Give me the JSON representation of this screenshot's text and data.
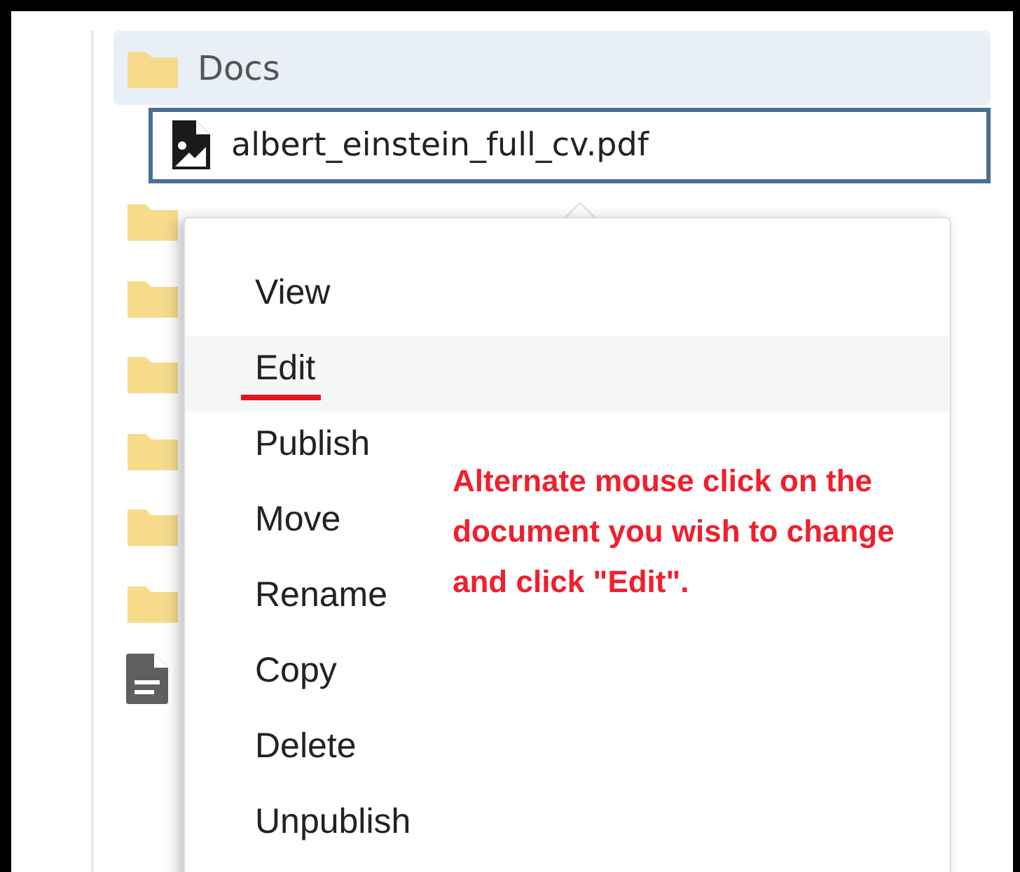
{
  "tree": {
    "folder": {
      "name": "Docs",
      "selected": true
    },
    "file": {
      "name": "albert_einstein_full_cv.pdf",
      "focused": true
    },
    "siblings": [
      {
        "kind": "folder"
      },
      {
        "kind": "folder"
      },
      {
        "kind": "folder"
      },
      {
        "kind": "folder"
      },
      {
        "kind": "folder"
      },
      {
        "kind": "folder"
      },
      {
        "kind": "document"
      }
    ]
  },
  "context_menu": {
    "items": [
      {
        "label": "View",
        "selected": false
      },
      {
        "label": "Edit",
        "selected": true
      },
      {
        "label": "Publish",
        "selected": false
      },
      {
        "label": "Move",
        "selected": false
      },
      {
        "label": "Rename",
        "selected": false
      },
      {
        "label": "Copy",
        "selected": false
      },
      {
        "label": "Delete",
        "selected": false
      },
      {
        "label": "Unpublish",
        "selected": false
      }
    ]
  },
  "annotation": "Alternate mouse click on the document you wish to change and click \"Edit\"."
}
